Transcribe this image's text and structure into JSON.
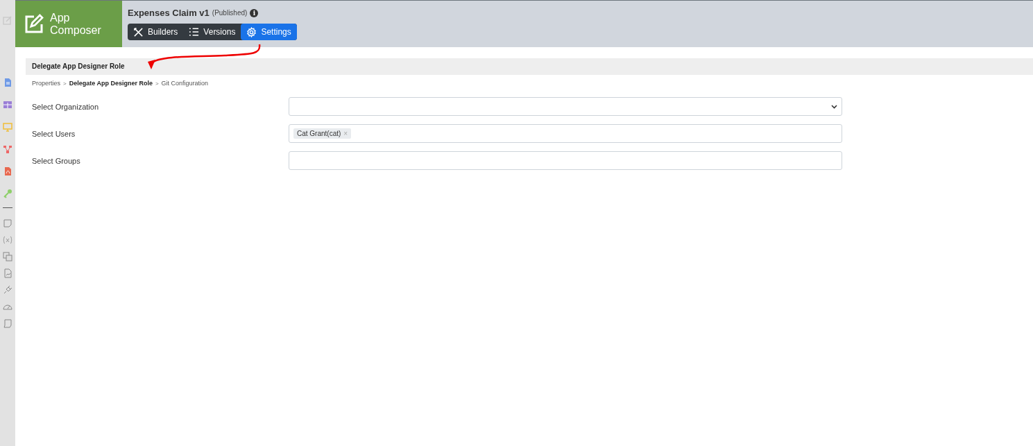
{
  "app": {
    "name_line1": "App",
    "name_line2": "Composer"
  },
  "header": {
    "title": "Expenses Claim v1",
    "status": "(Published)",
    "info_icon": "i"
  },
  "tabs": [
    {
      "label": "Builders",
      "kind": "builders",
      "selected": false
    },
    {
      "label": "Versions",
      "kind": "versions",
      "selected": false
    },
    {
      "label": "Settings",
      "kind": "settings",
      "selected": true
    }
  ],
  "section": {
    "title": "Delegate App Designer Role"
  },
  "breadcrumbs": [
    {
      "kind": "crumb",
      "label": "Properties",
      "selected": false
    },
    {
      "kind": "separator",
      "label": ">"
    },
    {
      "kind": "crumb",
      "label": "Delegate App Designer Role",
      "selected": true
    },
    {
      "kind": "separator",
      "label": ">"
    },
    {
      "kind": "crumb",
      "label": "Git Configuration",
      "selected": false
    }
  ],
  "form": [
    {
      "kind": "select",
      "label": "Select Organization"
    },
    {
      "kind": "tags",
      "label": "Select Users",
      "tags": [
        {
          "text": "Cat Grant(cat)",
          "remove": "×"
        }
      ]
    },
    {
      "kind": "text",
      "label": "Select Groups"
    }
  ]
}
